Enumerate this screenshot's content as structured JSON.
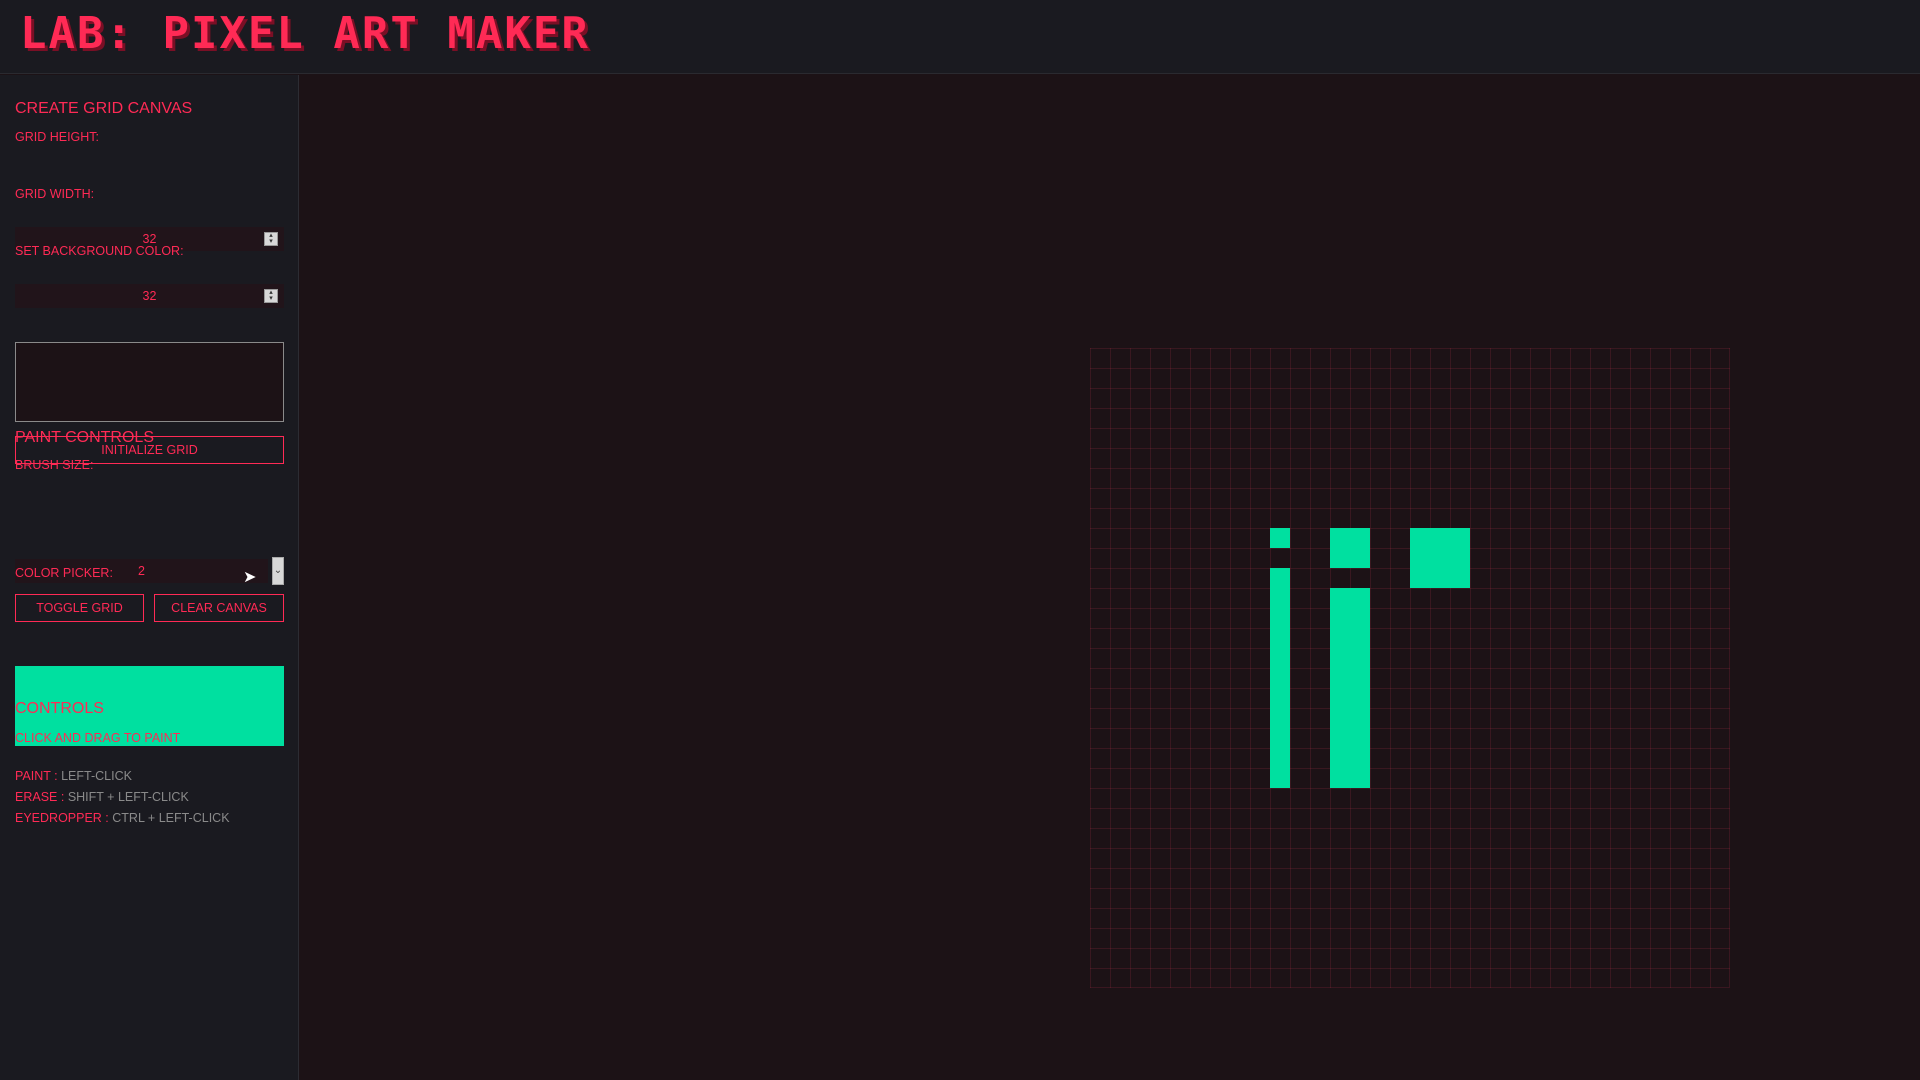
{
  "app": {
    "title": "LAB: PIXEL ART MAKER"
  },
  "create_grid": {
    "title": "CREATE GRID CANVAS",
    "height_label": "GRID HEIGHT:",
    "height_value": "32",
    "width_label": "GRID WIDTH:",
    "width_value": "32",
    "bg_label": "SET BACKGROUND COLOR:",
    "bg_color": "#1c1216",
    "init_button": "INITIALIZE GRID"
  },
  "paint_controls": {
    "title": "PAINT CONTROLS",
    "brush_label": "BRUSH SIZE:",
    "brush_value": "2",
    "toggle_grid_button": "TOGGLE GRID",
    "clear_canvas_button": "CLEAR CANVAS",
    "color_label": "COLOR PICKER:",
    "color_value": "#00e0a0"
  },
  "controls": {
    "title": "CONTROLS",
    "hint": "CLICK AND DRAG TO PAINT",
    "items": [
      {
        "key": "PAINT :",
        "value": "LEFT-CLICK"
      },
      {
        "key": "ERASE :",
        "value": "SHIFT + LEFT-CLICK"
      },
      {
        "key": "EYEDROPPER :",
        "value": "CTRL + LEFT-CLICK"
      }
    ]
  },
  "canvas": {
    "rows": 32,
    "cols": 32,
    "paint_color": "#00e0a0",
    "painted_rects": [
      {
        "col": 9,
        "row": 9,
        "w": 1,
        "h": 1
      },
      {
        "col": 9,
        "row": 11,
        "w": 1,
        "h": 11
      },
      {
        "col": 12,
        "row": 9,
        "w": 2,
        "h": 2
      },
      {
        "col": 12,
        "row": 12,
        "w": 2,
        "h": 10
      },
      {
        "col": 16,
        "row": 9,
        "w": 3,
        "h": 3
      }
    ]
  },
  "colors": {
    "accent": "#ff2a55",
    "sidebar_bg": "#1a1a20",
    "canvas_bg": "#1c1216"
  }
}
